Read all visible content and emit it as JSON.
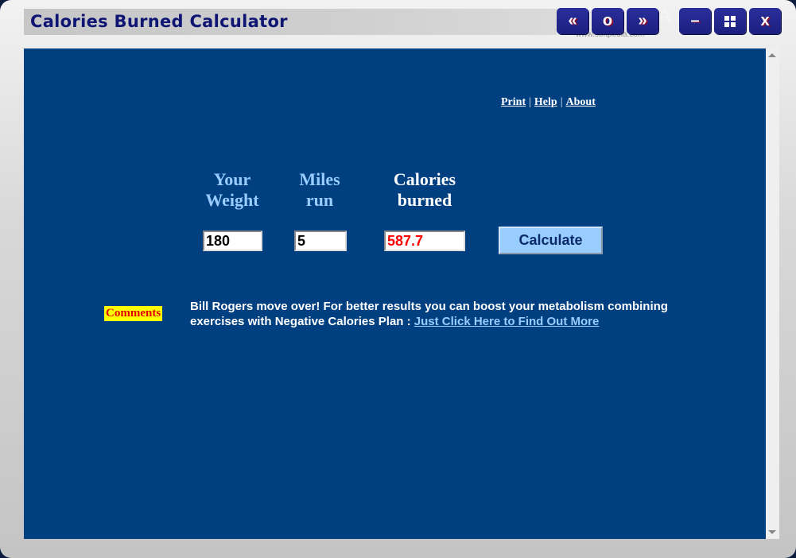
{
  "window": {
    "title": "Calories Burned Calculator",
    "nav_buttons": [
      {
        "name": "back",
        "glyph": "«"
      },
      {
        "name": "home",
        "glyph": "o"
      },
      {
        "name": "forward",
        "glyph": "»"
      }
    ],
    "control_buttons": [
      {
        "name": "minimize",
        "glyph": "–"
      },
      {
        "name": "maximize",
        "glyph": "▪▪"
      },
      {
        "name": "close",
        "glyph": "x"
      }
    ],
    "watermark": "SOFTPEDIA",
    "watermark_url": "www.softpedia.com"
  },
  "top_links": {
    "print": "Print",
    "help": "Help",
    "about": "About",
    "separator": "|"
  },
  "calculator": {
    "weight_header_line1": "Your",
    "weight_header_line2": "Weight",
    "miles_header_line1": "Miles",
    "miles_header_line2": "run",
    "calories_header_line1": "Calories",
    "calories_header_line2": "burned",
    "weight_value": "180",
    "miles_value": "5",
    "calories_value": "587.7",
    "calculate_label": "Calculate"
  },
  "comments": {
    "label": "Comments",
    "text": "Bill Rogers move over! For better results you can boost your metabolism combining exercises with Negative Calories Plan : ",
    "link_text": "Just Click Here to Find Out More"
  },
  "colors": {
    "content_bg": "#003f80",
    "header_light_blue": "#99ccff",
    "calories_result": "#ff0000",
    "comments_bg": "#ffff00"
  }
}
